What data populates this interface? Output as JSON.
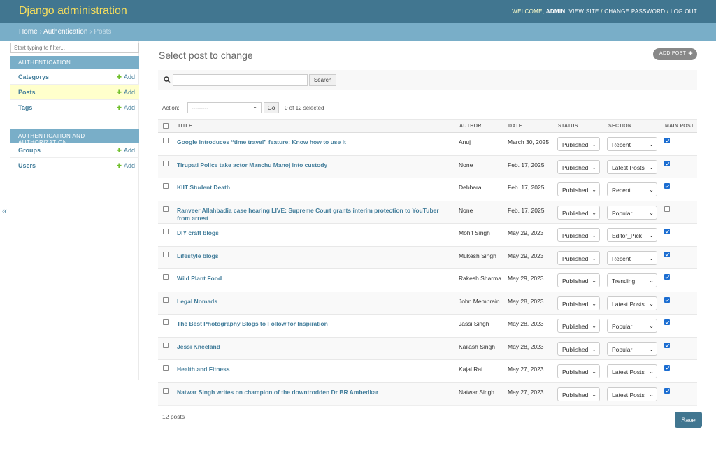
{
  "header": {
    "site_name": "Django administration",
    "welcome": "Welcome,",
    "username": "admin",
    "view_site": "View site",
    "change_password": "Change password",
    "log_out": "Log out",
    "sep": " / "
  },
  "breadcrumbs": {
    "home": "Home",
    "app": "Authentication",
    "current": "Posts",
    "sep": "›"
  },
  "sidebar": {
    "filter_placeholder": "Start typing to filter...",
    "toggle": "«",
    "modules": [
      {
        "caption": "AUTHENTICATION",
        "items": [
          {
            "name": "Categorys",
            "add": "Add"
          },
          {
            "name": "Posts",
            "add": "Add"
          },
          {
            "name": "Tags",
            "add": "Add"
          }
        ]
      },
      {
        "caption": "AUTHENTICATION AND AUTHORIZATION",
        "items": [
          {
            "name": "Groups",
            "add": "Add"
          },
          {
            "name": "Users",
            "add": "Add"
          }
        ]
      }
    ]
  },
  "content": {
    "title": "Select post to change",
    "add_button": "ADD POST",
    "search_button": "Search",
    "action_label": "Action:",
    "action_default": "---------",
    "go_button": "Go",
    "selected": "0 of 12 selected",
    "columns": [
      "TITLE",
      "AUTHOR",
      "DATE",
      "STATUS",
      "SECTION",
      "MAIN POST"
    ],
    "rows": [
      {
        "title": "Google introduces “time travel” feature: Know how to use it",
        "author": "Anuj",
        "date": "March 30, 2025",
        "status": "Published",
        "section": "Recent",
        "main": true
      },
      {
        "title": "Tirupati Police take actor Manchu Manoj into custody",
        "author": "None",
        "date": "Feb. 17, 2025",
        "status": "Published",
        "section": "Latest Posts",
        "main": true
      },
      {
        "title": "KIIT Student Death",
        "author": "Debbara",
        "date": "Feb. 17, 2025",
        "status": "Published",
        "section": "Recent",
        "main": true
      },
      {
        "title": "Ranveer Allahbadia case hearing LIVE: Supreme Court grants interim protection to YouTuber from arrest",
        "author": "None",
        "date": "Feb. 17, 2025",
        "status": "Published",
        "section": "Popular",
        "main": false
      },
      {
        "title": "DIY craft blogs",
        "author": "Mohit Singh",
        "date": "May 29, 2023",
        "status": "Published",
        "section": "Editor_Pick",
        "main": true
      },
      {
        "title": "Lifestyle blogs",
        "author": "Mukesh Singh",
        "date": "May 29, 2023",
        "status": "Published",
        "section": "Recent",
        "main": true
      },
      {
        "title": "Wild Plant Food",
        "author": "Rakesh Sharma",
        "date": "May 29, 2023",
        "status": "Published",
        "section": "Trending",
        "main": true
      },
      {
        "title": "Legal Nomads",
        "author": "John Membrain",
        "date": "May 28, 2023",
        "status": "Published",
        "section": "Latest Posts",
        "main": true
      },
      {
        "title": "The Best Photography Blogs to Follow for Inspiration",
        "author": "Jassi Singh",
        "date": "May 28, 2023",
        "status": "Published",
        "section": "Popular",
        "main": true
      },
      {
        "title": "Jessi Kneeland",
        "author": "Kailash Singh",
        "date": "May 28, 2023",
        "status": "Published",
        "section": "Popular",
        "main": true
      },
      {
        "title": "Health and Fitness",
        "author": "Kajal Rai",
        "date": "May 27, 2023",
        "status": "Published",
        "section": "Latest Posts",
        "main": true
      },
      {
        "title": "Natwar Singh writes on champion of the downtrodden Dr BR Ambedkar",
        "author": "Natwar Singh",
        "date": "May 27, 2023",
        "status": "Published",
        "section": "Latest Posts",
        "main": true
      }
    ],
    "count": "12 posts",
    "save_button": "Save"
  }
}
